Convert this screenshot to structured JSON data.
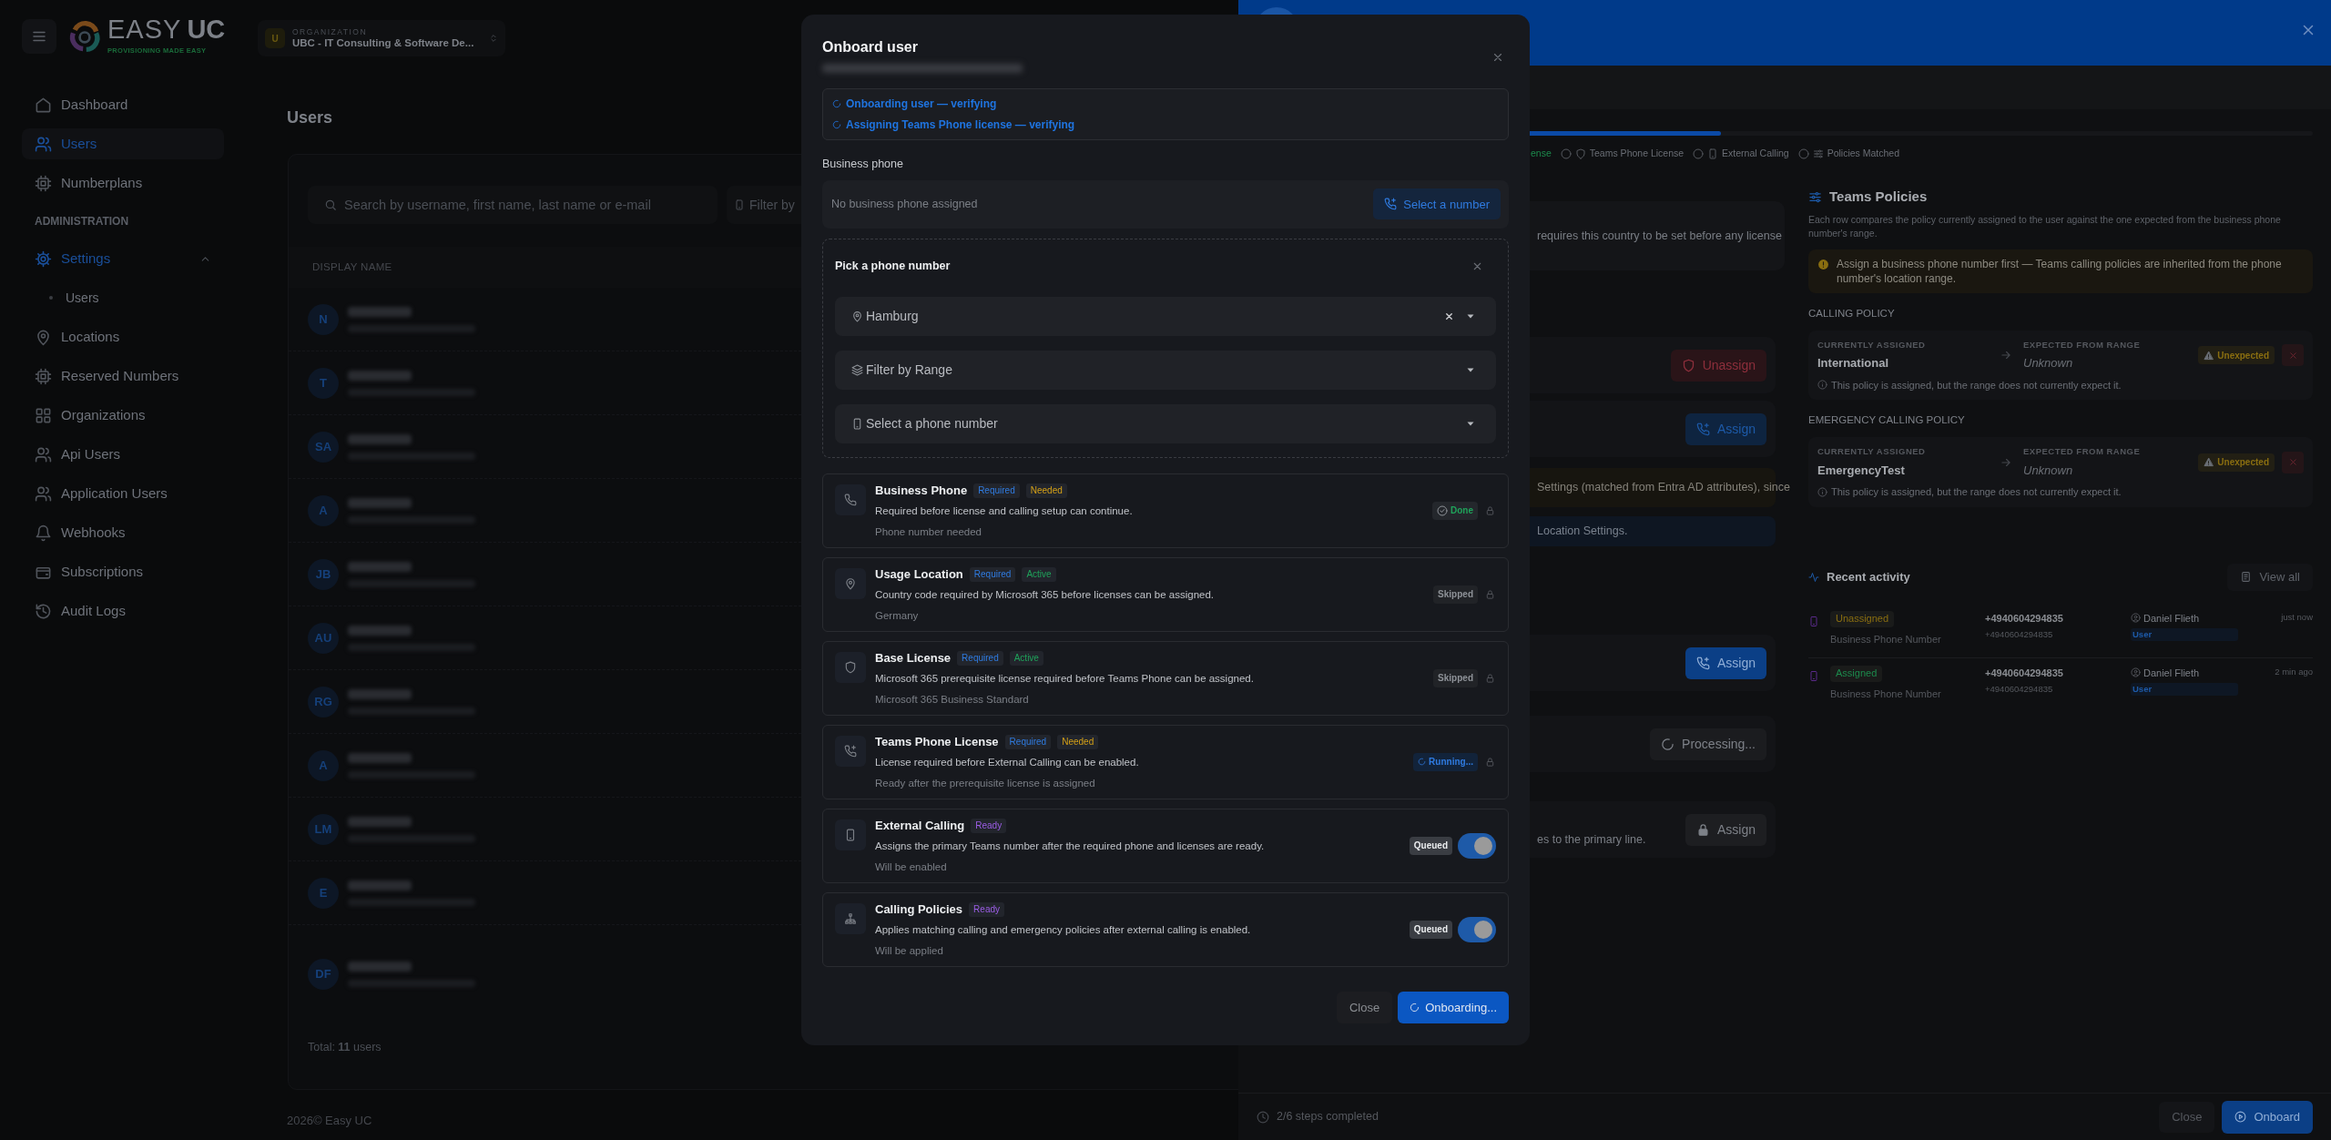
{
  "sidebar": {
    "logo": {
      "name_light": "EASY",
      "name_bold": "UC",
      "tagline": "PROVISIONING MADE EASY"
    },
    "items": [
      {
        "kind": "link",
        "label": "Dashboard",
        "selected": false
      },
      {
        "kind": "link",
        "label": "Users",
        "selected": true
      },
      {
        "kind": "link",
        "label": "Numberplans",
        "selected": false
      },
      {
        "kind": "section",
        "label": "ADMINISTRATION"
      },
      {
        "kind": "group",
        "label": "Settings",
        "expanded": true,
        "children": [
          {
            "label": "Users",
            "selected": false
          }
        ]
      },
      {
        "kind": "link",
        "label": "Locations",
        "selected": false
      },
      {
        "kind": "link",
        "label": "Reserved Numbers",
        "selected": false
      },
      {
        "kind": "link",
        "label": "Organizations",
        "selected": false
      },
      {
        "kind": "link",
        "label": "Api Users",
        "selected": false
      },
      {
        "kind": "link",
        "label": "Application Users",
        "selected": false
      },
      {
        "kind": "link",
        "label": "Webhooks",
        "selected": false
      },
      {
        "kind": "link",
        "label": "Subscriptions",
        "selected": false
      },
      {
        "kind": "link",
        "label": "Audit Logs",
        "selected": false
      }
    ]
  },
  "organization": {
    "badge": "U",
    "label": "ORGANIZATION",
    "value": "UBC - IT Consulting & Software De..."
  },
  "users_page": {
    "title": "Users",
    "search": {
      "placeholder": "Search by username, first name, last name or e-mail"
    },
    "filter": {
      "placeholder": "Filter by"
    },
    "columns": [
      "DISPLAY NAME"
    ],
    "rows": [
      {
        "initials": "N"
      },
      {
        "initials": "T"
      },
      {
        "initials": "SA"
      },
      {
        "initials": "A"
      },
      {
        "initials": "JB"
      },
      {
        "initials": "AU"
      },
      {
        "initials": "RG"
      },
      {
        "initials": "A"
      },
      {
        "initials": "LM"
      },
      {
        "initials": "E"
      },
      {
        "initials": "DF"
      }
    ],
    "total": "Total: **11** users",
    "footer": "2026© Easy UC"
  },
  "drawer": {
    "progress": {
      "level": 0.44
    },
    "steps": [
      {
        "label": "ense",
        "done": true
      },
      {
        "label": "Teams Phone License",
        "done": false
      },
      {
        "label": "External Calling",
        "done": false
      },
      {
        "label": "Policies Matched",
        "done": false
      }
    ],
    "blocks": [
      {
        "kind": "note",
        "text": "requires this country to be set before any license"
      },
      {
        "kind": "danger",
        "label": "Unassign"
      },
      {
        "kind": "secondary",
        "label": "Assign"
      },
      {
        "kind": "caution",
        "text": "Settings (matched from Entra AD attributes), since"
      },
      {
        "kind": "hint",
        "text": "Location Settings."
      },
      {
        "kind": "primary",
        "label": "Assign"
      },
      {
        "kind": "busy",
        "label": "Processing..."
      },
      {
        "kind": "locked",
        "label": "Assign",
        "note": "es to the primary line."
      }
    ],
    "policies": {
      "title": "Teams Policies",
      "description": "Each row compares the policy currently assigned to the user against the one expected from the business phone number's range.",
      "warning": "Assign a business phone number first — Teams calling policies are inherited from the phone number's location range.",
      "groups": [
        {
          "heading": "CALLING POLICY",
          "current_label": "CURRENTLY ASSIGNED",
          "current": "International",
          "expected_label": "EXPECTED FROM RANGE",
          "expected": "Unknown",
          "status": "Unexpected",
          "note": "This policy is assigned, but the range does not currently expect it."
        },
        {
          "heading": "EMERGENCY CALLING POLICY",
          "current_label": "CURRENTLY ASSIGNED",
          "current": "EmergencyTest",
          "expected_label": "EXPECTED FROM RANGE",
          "expected": "Unknown",
          "status": "Unexpected",
          "note": "This policy is assigned, but the range does not currently expect it."
        }
      ]
    },
    "activity": {
      "title": "Recent activity",
      "view_all": "View all",
      "items": [
        {
          "status": "Unassigned",
          "color": "#8a6e10",
          "type": "Business Phone Number",
          "number": "+4940604294835",
          "number_sub": "+4940604294835",
          "user": "Daniel Flieth",
          "role": "User",
          "time": "just now"
        },
        {
          "status": "Assigned",
          "color": "#1c8a4c",
          "type": "Business Phone Number",
          "number": "+4940604294835",
          "number_sub": "+4940604294835",
          "user": "Daniel Flieth",
          "role": "User",
          "time": "2 min ago"
        }
      ]
    },
    "footer": {
      "progress_text": "2/6 steps completed",
      "close": "Close",
      "onboard": "Onboard"
    }
  },
  "modal": {
    "title": "Onboard user",
    "status_lines": [
      "Onboarding user — verifying",
      "Assigning Teams Phone license — verifying"
    ],
    "business_phone": {
      "label": "Business phone",
      "value": "No business phone assigned",
      "action": "Select a number"
    },
    "picker": {
      "title": "Pick a phone number",
      "fields": [
        {
          "kind": "location",
          "value": "Hamburg"
        },
        {
          "kind": "range",
          "placeholder": "Filter by Range"
        },
        {
          "kind": "number",
          "placeholder": "Select a phone number"
        }
      ]
    },
    "steps": [
      {
        "title": "Business Phone",
        "badges": [
          {
            "text": "Required",
            "color": "#2f7be0"
          },
          {
            "text": "Needed",
            "color": "#d4a017"
          }
        ],
        "description": "Required before license and calling setup can continue.",
        "detail": "Phone number needed",
        "status": {
          "text": "Done",
          "kind": "done"
        },
        "control": {
          "kind": "lock"
        }
      },
      {
        "title": "Usage Location",
        "badges": [
          {
            "text": "Required",
            "color": "#2f7be0"
          },
          {
            "text": "Active",
            "color": "#1fa25a"
          }
        ],
        "description": "Country code required by Microsoft 365 before licenses can be assigned.",
        "detail": "Germany",
        "status": {
          "text": "Skipped",
          "kind": "skipped"
        },
        "control": {
          "kind": "lock"
        }
      },
      {
        "title": "Base License",
        "badges": [
          {
            "text": "Required",
            "color": "#2f7be0"
          },
          {
            "text": "Active",
            "color": "#1fa25a"
          }
        ],
        "description": "Microsoft 365 prerequisite license required before Teams Phone can be assigned.",
        "detail": "Microsoft 365 Business Standard",
        "status": {
          "text": "Skipped",
          "kind": "skipped"
        },
        "control": {
          "kind": "lock"
        }
      },
      {
        "title": "Teams Phone License",
        "badges": [
          {
            "text": "Required",
            "color": "#2f7be0"
          },
          {
            "text": "Needed",
            "color": "#d4a017"
          }
        ],
        "description": "License required before External Calling can be enabled.",
        "detail": "Ready after the prerequisite license is assigned",
        "status": {
          "text": "Running...",
          "kind": "running"
        },
        "control": {
          "kind": "lock"
        }
      },
      {
        "title": "External Calling",
        "badges": [
          {
            "text": "Ready",
            "color": "#9b5de5"
          }
        ],
        "description": "Assigns the primary Teams number after the required phone and licenses are ready.",
        "detail": "Will be enabled",
        "status": {
          "text": "Queued",
          "kind": "queued"
        },
        "control": {
          "kind": "toggle",
          "on": true
        }
      },
      {
        "title": "Calling Policies",
        "badges": [
          {
            "text": "Ready",
            "color": "#9b5de5"
          }
        ],
        "description": "Applies matching calling and emergency policies after external calling is enabled.",
        "detail": "Will be applied",
        "status": {
          "text": "Queued",
          "kind": "queued"
        },
        "control": {
          "kind": "toggle",
          "on": true
        }
      }
    ],
    "buttons": {
      "close": "Close",
      "submit": "Onboarding..."
    },
    "busy": true
  }
}
